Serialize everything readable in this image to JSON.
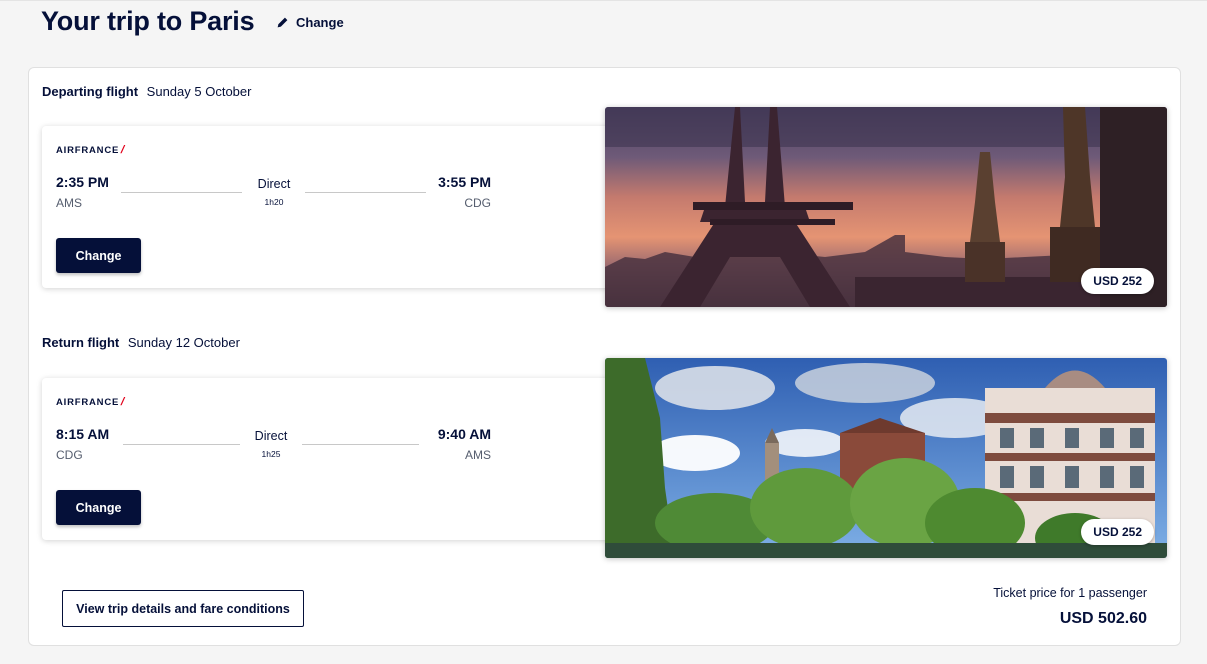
{
  "header": {
    "title": "Your trip to Paris",
    "change_label": "Change"
  },
  "departing": {
    "heading": "Departing flight",
    "date": "Sunday 5 October",
    "airline": "AIRFRANCE",
    "dep_time": "2:35 PM",
    "dep_code": "AMS",
    "arr_time": "3:55 PM",
    "arr_code": "CDG",
    "stops": "Direct",
    "duration": "1h20",
    "change_label": "Change",
    "price": "USD 252",
    "image_icon": "paris-eiffel-tower-photo"
  },
  "returning": {
    "heading": "Return flight",
    "date": "Sunday 12 October",
    "airline": "AIRFRANCE",
    "dep_time": "8:15 AM",
    "dep_code": "CDG",
    "arr_time": "9:40 AM",
    "arr_code": "AMS",
    "stops": "Direct",
    "duration": "1h25",
    "change_label": "Change",
    "price": "USD 252",
    "image_icon": "amsterdam-canal-houses-photo"
  },
  "footer": {
    "details_label": "View trip details and fare conditions",
    "ticket_label": "Ticket price for 1 passenger",
    "total": "USD 502.60"
  },
  "colors": {
    "navy": "#051039",
    "airline_red": "#e1001a",
    "background": "#f5f5f5"
  }
}
